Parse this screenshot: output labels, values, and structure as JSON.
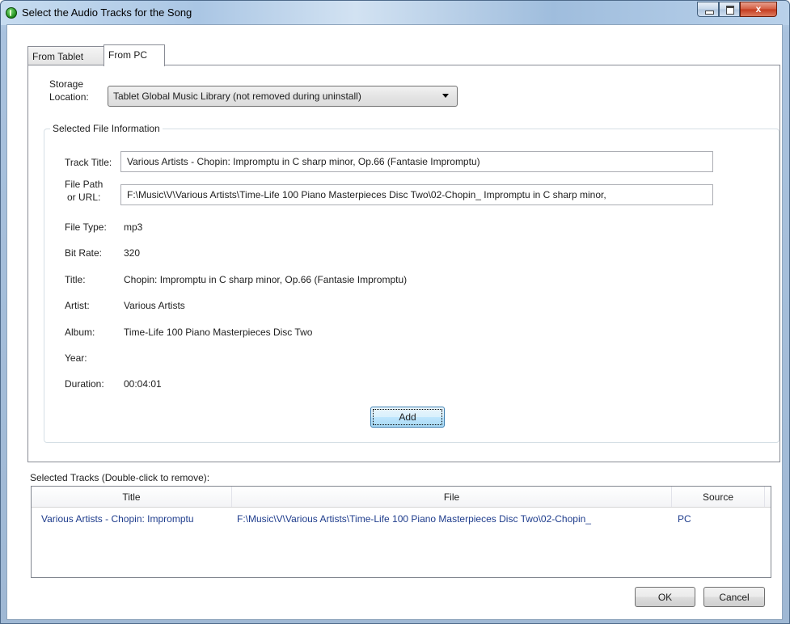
{
  "window": {
    "title": "Select the Audio Tracks for the Song",
    "controls": {
      "minimize": "_",
      "maximize": "□",
      "close": "x"
    }
  },
  "tabs": [
    {
      "label": "From Tablet",
      "selected": false
    },
    {
      "label": "From PC",
      "selected": true
    }
  ],
  "storage": {
    "label_line1": "Storage",
    "label_line2": "Location:",
    "selected": "Tablet Global Music Library (not removed during uninstall)"
  },
  "file_info": {
    "group_title": "Selected File Information",
    "track_title_label": "Track Title:",
    "track_title_value": "Various Artists - Chopin: Impromptu in C sharp minor, Op.66 (Fantasie Impromptu)",
    "file_path_label_line1": "File Path",
    "file_path_label_line2": "or URL:",
    "file_path_value": "F:\\Music\\V\\Various Artists\\Time-Life 100 Piano Masterpieces Disc Two\\02-Chopin_ Impromptu in C sharp minor,",
    "file_type_label": "File Type:",
    "file_type_value": "mp3",
    "bit_rate_label": "Bit Rate:",
    "bit_rate_value": "320",
    "title_label": "Title:",
    "title_value": "Chopin: Impromptu in C sharp minor, Op.66 (Fantasie Impromptu)",
    "artist_label": "Artist:",
    "artist_value": "Various Artists",
    "album_label": "Album:",
    "album_value": "Time-Life 100 Piano Masterpieces Disc Two",
    "year_label": "Year:",
    "year_value": "",
    "duration_label": "Duration:",
    "duration_value": "00:04:01",
    "add_button": "Add"
  },
  "selected_tracks": {
    "caption": "Selected Tracks (Double-click to remove):",
    "columns": [
      "Title",
      "File",
      "Source"
    ],
    "rows": [
      {
        "title": "Various Artists - Chopin: Impromptu",
        "file": "F:\\Music\\V\\Various Artists\\Time-Life 100 Piano Masterpieces Disc Two\\02-Chopin_",
        "source": "PC"
      }
    ]
  },
  "footer": {
    "ok": "OK",
    "cancel": "Cancel"
  }
}
